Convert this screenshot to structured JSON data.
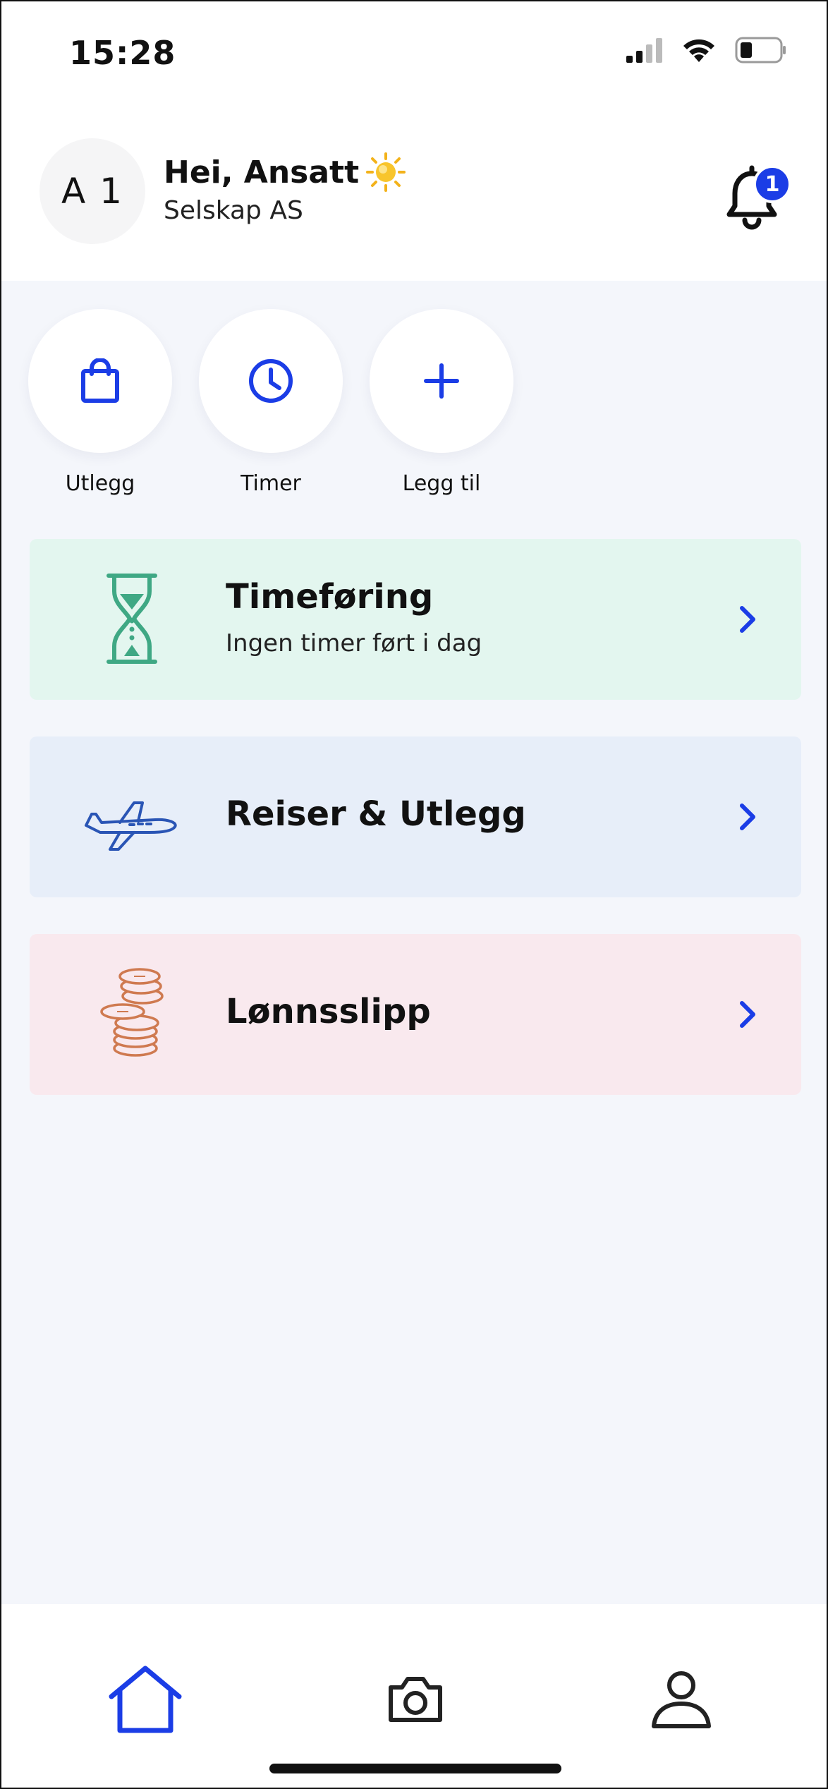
{
  "status_bar": {
    "time": "15:28",
    "icons": [
      "cellular-signal-icon",
      "wifi-icon",
      "battery-icon"
    ]
  },
  "header": {
    "avatar_initials": "A 1",
    "greeting": "Hei, Ansatt",
    "greeting_icon": "sun-icon",
    "company": "Selskap AS",
    "notification_count": "1"
  },
  "quick_actions": [
    {
      "label": "Utlegg",
      "icon": "shopping-bag-icon"
    },
    {
      "label": "Timer",
      "icon": "clock-icon"
    },
    {
      "label": "Legg til",
      "icon": "plus-icon"
    }
  ],
  "cards": [
    {
      "title": "Timeføring",
      "subtitle": "Ingen timer ført i dag",
      "icon": "hourglass-icon",
      "background": "#e3f6ef"
    },
    {
      "title": "Reiser & Utlegg",
      "icon": "airplane-icon",
      "background": "#e7eef9"
    },
    {
      "title": "Lønnsslipp",
      "icon": "coins-icon",
      "background": "#f9e9ee"
    }
  ],
  "bottom_nav": [
    {
      "name": "home",
      "icon": "home-icon",
      "active": true
    },
    {
      "name": "camera",
      "icon": "camera-icon",
      "active": false
    },
    {
      "name": "profile",
      "icon": "user-icon",
      "active": false
    }
  ],
  "colors": {
    "accent": "#1b3de6",
    "hourglass": "#3fa884",
    "airplane": "#2a55b5",
    "coins": "#cf7a50",
    "background": "#f4f6fb"
  }
}
